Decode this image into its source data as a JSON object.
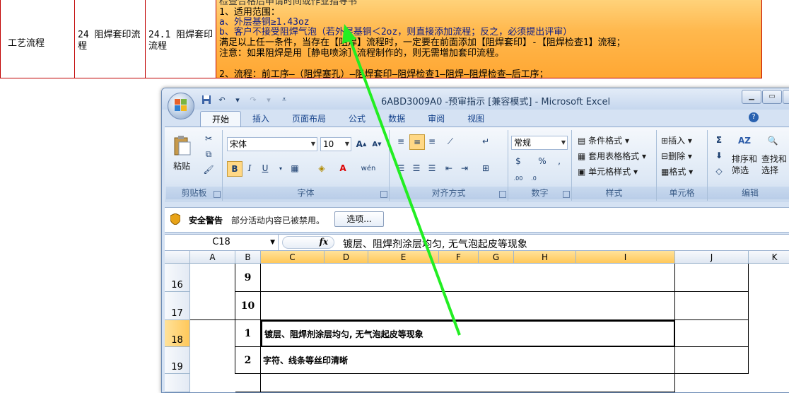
{
  "doc_table": {
    "col1": "工艺流程",
    "col2": "24 阻焊套印流程",
    "col3": "24.1 阻焊套印流程",
    "top_cut": "检查合格后申请时间或作业指导书",
    "lines": [
      "1、适用范围：",
      "  a、外层基铜≥1.43oz",
      "  b、客户不接受阻焊气泡（若外层基铜＜2oz，则直接添加流程；反之，必须提出评审）",
      " 满足以上任一条件，当存在【阻焊】流程时，一定要在前面添加【阻焊套印】-【阻焊检查1】流程；",
      "注意：如果阻焊是用［静电喷涂］流程制作的，则无需增加套印流程。",
      "",
      "2、流程：前工序—（阻焊塞孔）—阻焊套印—阻焊检查1—阻焊—阻焊检查—后工序；"
    ]
  },
  "excel": {
    "title": "6ABD3009A0 -预审指示  [兼容模式] - Microsoft Excel",
    "tabs": [
      "开始",
      "插入",
      "页面布局",
      "公式",
      "数据",
      "审阅",
      "视图"
    ],
    "clipboard": {
      "paste": "粘贴",
      "label": "剪贴板"
    },
    "font": {
      "name": "宋体",
      "size": "10",
      "label": "字体"
    },
    "align": {
      "label": "对齐方式"
    },
    "number": {
      "format": "常规",
      "label": "数字"
    },
    "styles": {
      "cond": "条件格式",
      "table": "套用表格格式",
      "cell": "单元格样式",
      "label": "样式"
    },
    "cells": {
      "insert": "插入",
      "delete": "删除",
      "format": "格式",
      "label": "单元格"
    },
    "editing": {
      "sort": "排序和",
      "filter": "筛选",
      "find": "查找和",
      "select": "选择",
      "label": "编辑"
    },
    "security": {
      "title": "安全警告",
      "msg": "部分活动内容已被禁用。",
      "btn": "选项..."
    },
    "namebox": "C18",
    "formula": "镀层、阻焊剂涂层均匀, 无气泡起皮等现象",
    "columns": [
      "A",
      "B",
      "C",
      "D",
      "E",
      "F",
      "G",
      "H",
      "I",
      "J",
      "K"
    ],
    "rows": [
      {
        "rownum": "16",
        "b": "9",
        "c": ""
      },
      {
        "rownum": "17",
        "b": "10",
        "c": ""
      },
      {
        "rownum": "18",
        "b": "1",
        "c": "镀层、阻焊剂涂层均匀, 无气泡起皮等现象"
      },
      {
        "rownum": "19",
        "b": "2",
        "c": "字符、线条等丝印清晰"
      }
    ]
  },
  "annotation": {
    "arrow_color": "#22ee22"
  }
}
